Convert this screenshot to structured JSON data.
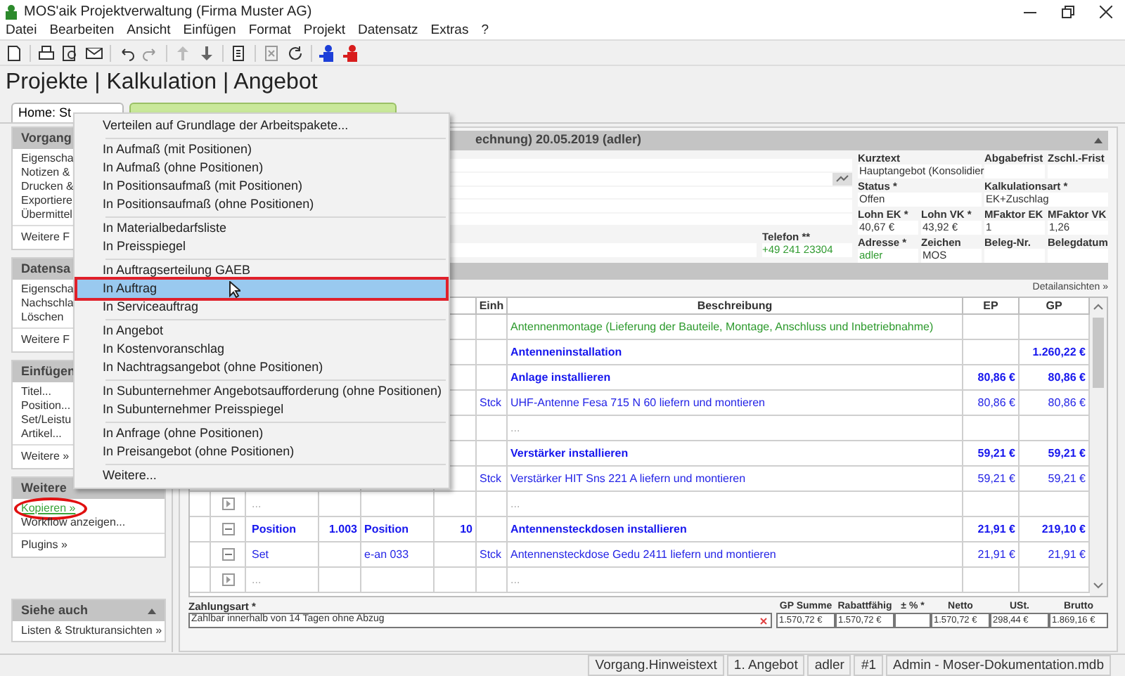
{
  "window": {
    "title": "MOS'aik Projektverwaltung (Firma Muster AG)"
  },
  "menu_bar": [
    "Datei",
    "Bearbeiten",
    "Ansicht",
    "Einfügen",
    "Format",
    "Projekt",
    "Datensatz",
    "Extras",
    "?"
  ],
  "heading": "Projekte | Kalkulation | Angebot",
  "tabs": [
    {
      "label": "Home: St",
      "selected": false
    },
    {
      "selected": true
    }
  ],
  "sidebar": [
    {
      "title": "Vorgang",
      "groups": [
        [
          {
            "label": "Eigenscha",
            "kind": "action",
            "circled": false
          },
          {
            "label": "Notizen &",
            "kind": "action",
            "circled": false
          },
          {
            "label": "Drucken &",
            "kind": "action",
            "circled": false
          },
          {
            "label": "Exportiere",
            "kind": "action",
            "circled": false
          },
          {
            "label": "Übermittel",
            "kind": "action",
            "circled": false
          }
        ],
        [
          {
            "label": "Weitere F",
            "kind": "action",
            "circled": false
          }
        ]
      ]
    },
    {
      "title": "Datensa",
      "groups": [
        [
          {
            "label": "Eigenscha",
            "kind": "action",
            "circled": false
          },
          {
            "label": "Nachschla",
            "kind": "action",
            "circled": false
          },
          {
            "label": "Löschen",
            "kind": "action",
            "circled": false
          }
        ],
        [
          {
            "label": "Weitere F",
            "kind": "action",
            "circled": false
          }
        ]
      ]
    },
    {
      "title": "Einfügen",
      "groups": [
        [
          {
            "label": "Titel...",
            "kind": "action",
            "circled": false
          },
          {
            "label": "Position...",
            "kind": "action",
            "circled": false
          },
          {
            "label": "Set/Leistu",
            "kind": "action",
            "circled": false
          },
          {
            "label": "Artikel...",
            "kind": "action",
            "circled": false
          }
        ],
        [
          {
            "label": "Weitere »",
            "kind": "action",
            "circled": false
          }
        ]
      ]
    },
    {
      "title": "Weitere",
      "groups": [
        [
          {
            "label": "Kopieren »",
            "kind": "link",
            "circled": true
          },
          {
            "label": "Workflow anzeigen...",
            "kind": "action",
            "circled": false
          }
        ],
        [
          {
            "label": "Plugins »",
            "kind": "action",
            "circled": false
          }
        ]
      ]
    },
    {
      "title": "Siehe auch",
      "collapsible": true,
      "groups": [
        [
          {
            "label": "Listen & Strukturansichten »",
            "kind": "action",
            "circled": false
          }
        ]
      ]
    }
  ],
  "record": {
    "header": "echnung) 20.05.2019 (adler)",
    "phone": {
      "label": "Telefon **",
      "value": "+49 241 23304"
    },
    "fields": [
      {
        "label": "Kurztext",
        "value": "Hauptangebot (Konsolidier",
        "link": false
      },
      {
        "label": "Abgabefrist"
      },
      {
        "label": "Zschl.-Frist"
      },
      {
        "label": "Status *",
        "value": "Offen",
        "link": false
      },
      {
        "label": "Kalkulationsart *",
        "value": "EK+Zuschlag",
        "link": false
      },
      {
        "label": "Lohn EK *",
        "value": "40,67 €",
        "link": false
      },
      {
        "label": "Lohn VK *",
        "value": "43,92 €",
        "link": false
      },
      {
        "label": "MFaktor EK",
        "value": "1",
        "link": false
      },
      {
        "label": "MFaktor VK",
        "value": "1,26",
        "link": false
      },
      {
        "label": "Adresse *",
        "value": "adler",
        "link": true
      },
      {
        "label": "Zeichen",
        "value": "MOS",
        "link": false
      },
      {
        "label": "Beleg-Nr."
      },
      {
        "label": "Belegdatum"
      }
    ]
  },
  "positions": {
    "link": "Detailansichten »",
    "columns": [
      {
        "label": "Einh"
      },
      {
        "label": "Beschreibung"
      },
      {
        "label": "EP"
      },
      {
        "label": "GP"
      }
    ],
    "rows": [
      {
        "kind": "note",
        "description": "Antennenmontage (Lieferung der Bauteile, Montage, Anschluss und Inbetriebnahme)"
      },
      {
        "kind": "title",
        "description": "Antenneninstallation",
        "gp": "1.260,22 €"
      },
      {
        "kind": "title",
        "description": "Anlage installieren",
        "ep": "80,86 €",
        "gp": "80,86 €"
      },
      {
        "kind": "item",
        "unit": "Stck",
        "description": "UHF-Antenne Fesa 715 N 60 liefern und montieren",
        "ep": "80,86 €",
        "gp": "80,86 €"
      },
      {
        "kind": "empty",
        "description": "..."
      },
      {
        "kind": "title",
        "description": "Verstärker installieren",
        "ep": "59,21 €",
        "gp": "59,21 €"
      },
      {
        "kind": "item",
        "unit": "Stck",
        "description": "Verstärker HIT Sns 221 A liefern und montieren",
        "ep": "59,21 €",
        "gp": "59,21 €"
      },
      {
        "kind": "empty",
        "expanded": false,
        "col_1": "...",
        "description": "..."
      },
      {
        "kind": "title",
        "expanded": true,
        "col_1": "Position",
        "col_2": "1.003",
        "col_3": "Position",
        "col_4": "10",
        "description": "Antennensteckdosen installieren",
        "ep": "21,91 €",
        "gp": "219,10 €"
      },
      {
        "kind": "item",
        "expanded": true,
        "col_1": "Set",
        "col_3": "e-an 033",
        "unit": "Stck",
        "description": "Antennensteckdose Gedu 2411 liefern und montieren",
        "ep": "21,91 €",
        "gp": "21,91 €"
      },
      {
        "kind": "empty",
        "expanded": false,
        "col_1": "...",
        "description": "..."
      }
    ]
  },
  "totals": {
    "payment": {
      "label": "Zahlungsart *",
      "value": "Zahlbar innerhalb von 14 Tagen ohne Abzug"
    },
    "sums": [
      {
        "label": "GP Summe",
        "value": "1.570,72 €"
      },
      {
        "label": "Rabattfähig",
        "value": "1.570,72 €"
      },
      {
        "label": "± % *"
      },
      {
        "label": "Netto",
        "value": "1.570,72 €"
      },
      {
        "label": "USt.",
        "value": "298,44 €"
      },
      {
        "label": "Brutto",
        "value": "1.869,16 €"
      }
    ]
  },
  "context_menu": [
    [
      {
        "label": "Verteilen auf Grundlage der Arbeitspakete...",
        "selected": false
      }
    ],
    [
      {
        "label": "In Aufmaß (mit Positionen)",
        "selected": false
      },
      {
        "label": "In Aufmaß (ohne Positionen)",
        "selected": false
      },
      {
        "label": "In Positionsaufmaß (mit Positionen)",
        "selected": false
      },
      {
        "label": "In Positionsaufmaß (ohne Positionen)",
        "selected": false
      }
    ],
    [
      {
        "label": "In Materialbedarfsliste",
        "selected": false
      },
      {
        "label": "In Preisspiegel",
        "selected": false
      }
    ],
    [
      {
        "label": "In Auftragserteilung GAEB",
        "selected": false
      },
      {
        "label": "In Auftrag",
        "selected": true
      },
      {
        "label": "In Serviceauftrag",
        "selected": false
      }
    ],
    [
      {
        "label": "In Angebot",
        "selected": false
      },
      {
        "label": "In Kostenvoranschlag",
        "selected": false
      },
      {
        "label": "In Nachtragsangebot (ohne Positionen)",
        "selected": false
      }
    ],
    [
      {
        "label": "In Subunternehmer Angebotsaufforderung (ohne Positionen)",
        "selected": false
      },
      {
        "label": "In Subunternehmer Preisspiegel",
        "selected": false
      }
    ],
    [
      {
        "label": "In Anfrage (ohne Positionen)",
        "selected": false
      },
      {
        "label": "In Preisangebot (ohne Positionen)",
        "selected": false
      }
    ],
    [
      {
        "label": "Weitere...",
        "selected": false
      }
    ]
  ],
  "status_bar": [
    "Vorgang.Hinweistext",
    "1. Angebot",
    "adler",
    "#1",
    "Admin - Moser-Dokumentation.mdb"
  ]
}
